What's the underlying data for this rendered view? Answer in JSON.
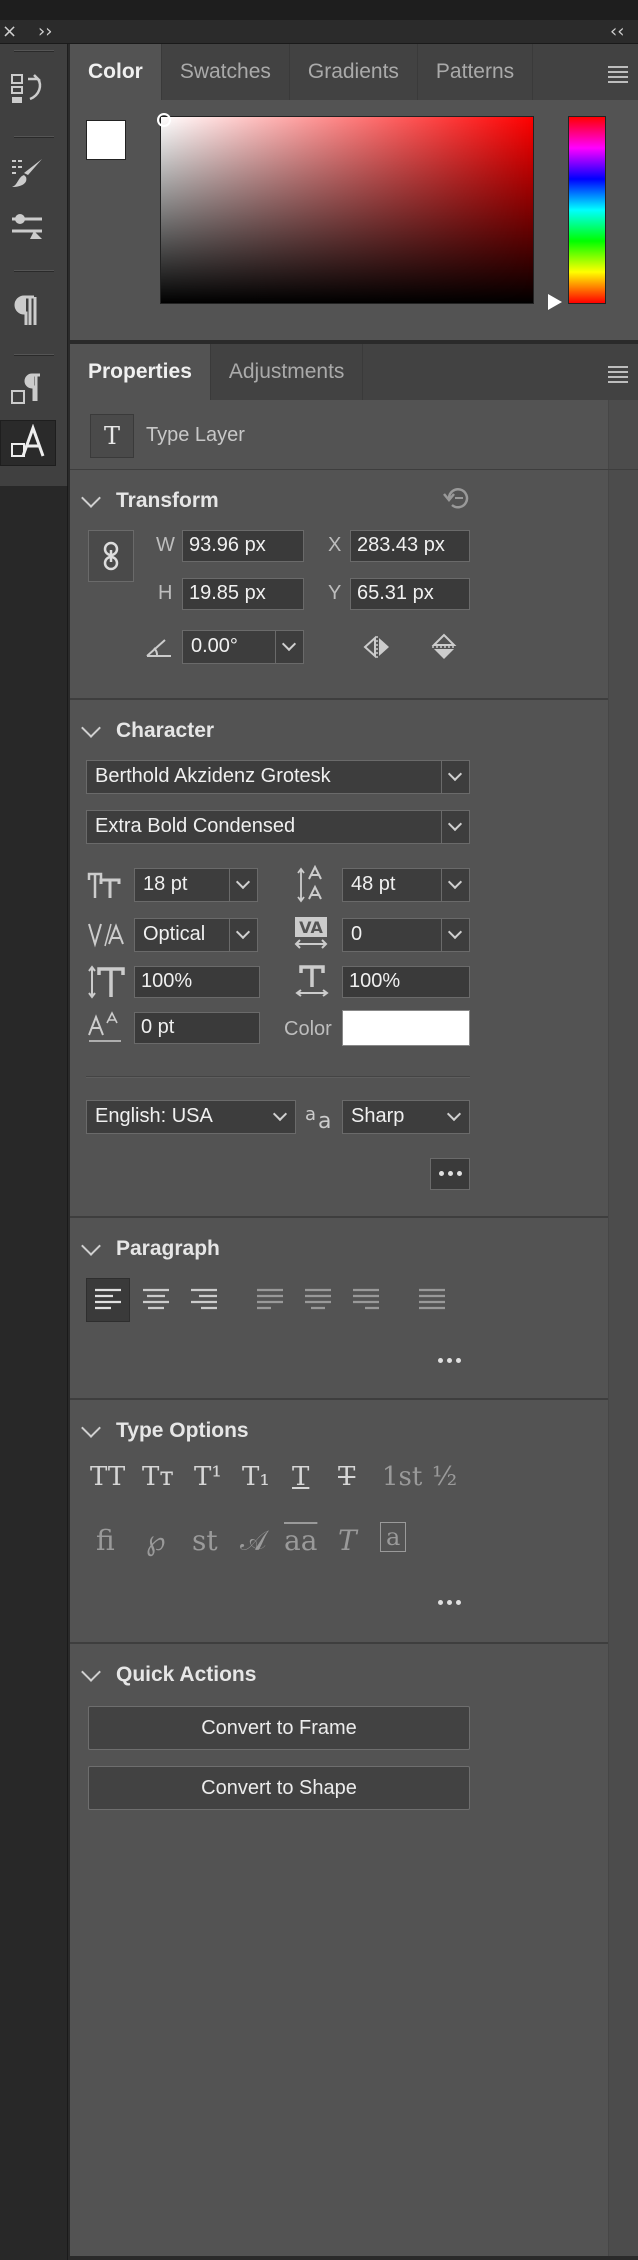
{
  "window": {
    "close_glyph": "×",
    "collapse_glyph": "››",
    "expand_glyph": "‹‹"
  },
  "color_panel": {
    "tabs": [
      "Color",
      "Swatches",
      "Gradients",
      "Patterns"
    ],
    "foreground": "#ffffff",
    "background": "#000000",
    "field_hue": "#ff0000"
  },
  "properties_panel": {
    "tabs": [
      "Properties",
      "Adjustments"
    ],
    "layer": {
      "icon": "type-layer-icon",
      "icon_glyph": "T",
      "label": "Type Layer"
    },
    "transform": {
      "title": "Transform",
      "w_label": "W",
      "w_value": "93.96 px",
      "h_label": "H",
      "h_value": "19.85 px",
      "x_label": "X",
      "x_value": "283.43 px",
      "y_label": "Y",
      "y_value": "65.31 px",
      "angle_value": "0.00°"
    },
    "character": {
      "title": "Character",
      "font_family": "Berthold Akzidenz Grotesk",
      "font_style": "Extra Bold Condensed",
      "font_size": "18 pt",
      "leading": "48 pt",
      "kerning": "Optical",
      "tracking": "0",
      "vertical_scale": "100%",
      "horizontal_scale": "100%",
      "baseline_shift": "0 pt",
      "color_label": "Color",
      "color_value": "#ffffff",
      "language": "English: USA",
      "antialias": "Sharp"
    },
    "paragraph": {
      "title": "Paragraph"
    },
    "type_options": {
      "title": "Type Options",
      "row1": [
        "TT",
        "Tт",
        "T¹",
        "T₁",
        "T",
        "T",
        "1st",
        "½"
      ],
      "row2": [
        "ﬁ",
        "℘",
        "st",
        "𝒜",
        "aa",
        "T",
        "a"
      ]
    },
    "quick_actions": {
      "title": "Quick Actions",
      "convert_frame": "Convert to Frame",
      "convert_shape": "Convert to Shape"
    }
  }
}
